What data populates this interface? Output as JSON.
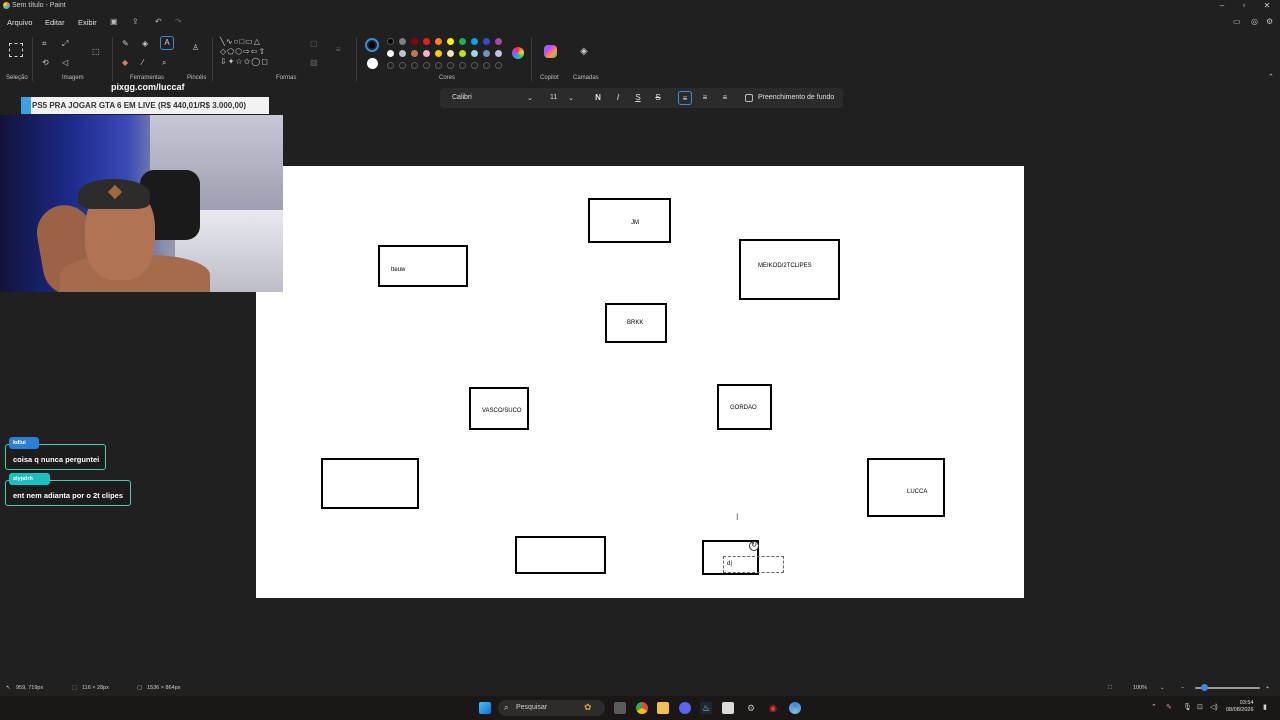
{
  "window": {
    "title": "Sem título - Paint",
    "buttons": [
      "minimize-icon",
      "maximize-icon",
      "close-icon"
    ]
  },
  "menu": {
    "items": [
      "Arquivo",
      "Editar",
      "Exibir"
    ]
  },
  "ribbon": {
    "groups": [
      "Seleção",
      "Imagem",
      "Ferramentas",
      "Pincéis",
      "Formas",
      "Cores",
      "Copilot",
      "Camadas"
    ]
  },
  "colors": {
    "row1": [
      "#000000",
      "#7f7f7f",
      "#880015",
      "#ed1c24",
      "#ff7f27",
      "#fff200",
      "#22b14c",
      "#00a2e8",
      "#3f48cc",
      "#a349a4"
    ],
    "row2": [
      "#ffffff",
      "#c3c3c3",
      "#b97a57",
      "#ffaec9",
      "#ffc90e",
      "#efe4b0",
      "#b5e61d",
      "#99d9ea",
      "#7092be",
      "#c8bfe7"
    ],
    "primary": "#000000",
    "secondary": "#ffffff"
  },
  "text_toolbar": {
    "font": "Calibri",
    "size": "11",
    "bold": "N",
    "italic": "I",
    "underline": "S",
    "strike": "S",
    "fill_label": "Preenchimento de fundo"
  },
  "canvas_boxes": [
    {
      "label": "JM"
    },
    {
      "label": "tteuw"
    },
    {
      "label": "MEIKOD/2TCLIPES"
    },
    {
      "label": "BRKK"
    },
    {
      "label": "VASCO/SUCO"
    },
    {
      "label": "GORDAO"
    },
    {
      "label": ""
    },
    {
      "label": "LUCCA"
    },
    {
      "label": ""
    },
    {
      "label": ""
    }
  ],
  "typing_text": "d|",
  "stream": {
    "pix": "pixgg.com/luccaf",
    "banner": "PS5 PRA JOGAR GTA 6 EM LIVE (R$ 440,01/R$ 3.000,00)",
    "chat": [
      {
        "user": "kdlui",
        "user_color": "#2c7fd6",
        "message": "coisa q nunca perguntei"
      },
      {
        "user": "slypdrh",
        "user_color": "#18c2c2",
        "message": "ent nem adianta por o 2t clipes"
      }
    ]
  },
  "status": {
    "cursor": "959, 719px",
    "selection": "116 × 28px",
    "canvas_size": "1536 × 864px",
    "zoom": "100%"
  },
  "taskbar": {
    "search_placeholder": "Pesquisar",
    "time": "03:54",
    "date": "08/08/2026"
  }
}
